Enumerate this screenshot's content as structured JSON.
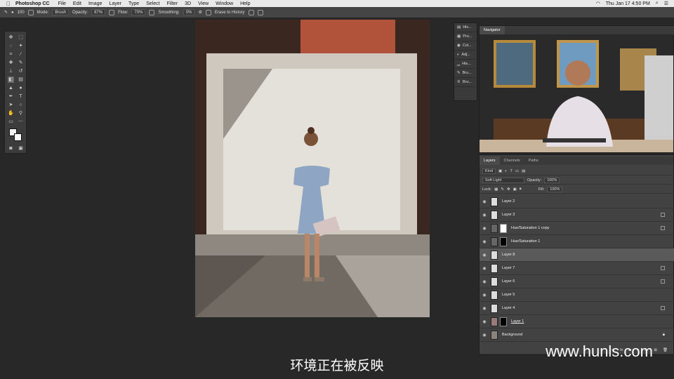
{
  "menubar": {
    "app_name": "Photoshop CC",
    "items": [
      "File",
      "Edit",
      "Image",
      "Layer",
      "Type",
      "Select",
      "Filter",
      "3D",
      "View",
      "Window",
      "Help"
    ],
    "clock": "Thu Jan 17  4:50 PM"
  },
  "options": {
    "brush_size": "100",
    "mode_label": "Mode:",
    "mode_value": "Brush",
    "opacity_label": "Opacity:",
    "opacity_value": "87%",
    "flow_label": "Flow:",
    "flow_value": "70%",
    "smoothing_label": "Smoothing:",
    "smoothing_value": "0%",
    "erase_history": "Erase to History"
  },
  "minidock": [
    "His...",
    "Pro...",
    "Col...",
    "Adj...",
    "His...",
    "Bru...",
    "Bru..."
  ],
  "navigator": {
    "tab": "Navigator"
  },
  "layers_panel": {
    "tabs": [
      "Layers",
      "Channels",
      "Paths"
    ],
    "kind": "Kind",
    "blend_mode": "Soft Light",
    "opacity_label": "Opacity:",
    "opacity_value": "100%",
    "lock_label": "Lock:",
    "fill_label": "Fill:",
    "fill_value": "100%",
    "layers": [
      {
        "name": "Layer 2",
        "mask": false,
        "fx": false,
        "selected": false
      },
      {
        "name": "Layer 3",
        "mask": false,
        "fx": true,
        "selected": false
      },
      {
        "name": "Hue/Saturation 1 copy",
        "mask": true,
        "fx": true,
        "selected": false
      },
      {
        "name": "Hue/Saturation 1",
        "mask": true,
        "fx": false,
        "selected": false
      },
      {
        "name": "Layer 8",
        "mask": false,
        "fx": false,
        "selected": true
      },
      {
        "name": "Layer 7",
        "mask": false,
        "fx": true,
        "selected": false
      },
      {
        "name": "Layer 6",
        "mask": false,
        "fx": true,
        "selected": false
      },
      {
        "name": "Layer 5",
        "mask": false,
        "fx": false,
        "selected": false
      },
      {
        "name": "Layer 4",
        "mask": false,
        "fx": true,
        "selected": false
      },
      {
        "name": "Layer 1",
        "mask": true,
        "fx": false,
        "selected": false
      },
      {
        "name": "Background",
        "mask": false,
        "fx": false,
        "selected": false
      }
    ]
  },
  "subtitle": "环境正在被反映",
  "watermark": "www.hunls.com"
}
